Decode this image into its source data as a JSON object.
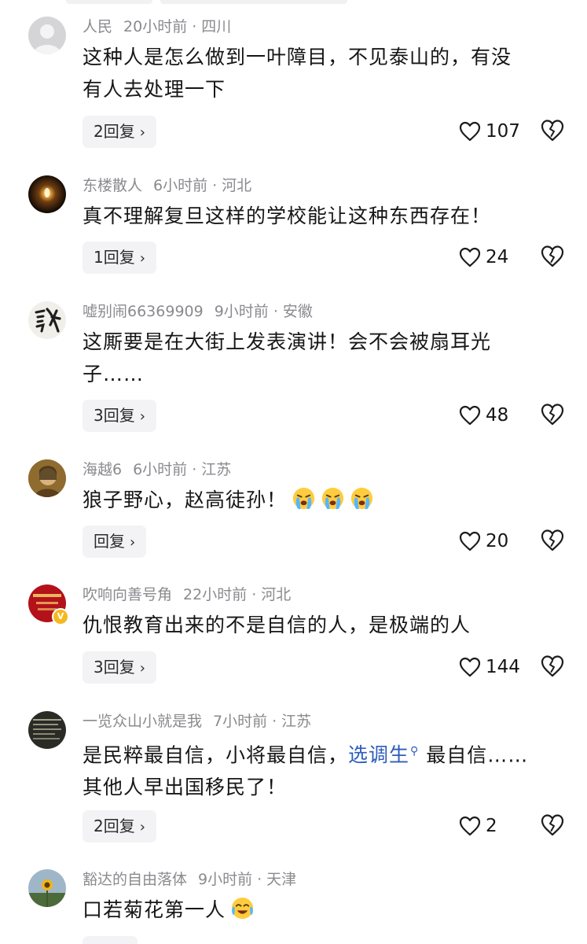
{
  "comments": [
    {
      "avatar": "default-user-avatar",
      "username": "人民",
      "time": "20小时前",
      "location": "四川",
      "lines": [
        "这种人是怎么做到一叶障目，不见泰山的，有没",
        "有人去处理一下"
      ],
      "reply_label": "2回复",
      "likes": "107"
    },
    {
      "avatar": "candle-light-avatar",
      "username": "东楼散人",
      "time": "6小时前",
      "location": "河北",
      "lines": [
        "真不理解复旦这样的学校能让这种东西存在！"
      ],
      "reply_label": "1回复",
      "likes": "24"
    },
    {
      "avatar": "calligraphy-character-avatar",
      "avatar_text": "䛓",
      "username": "嘘别闹66369909",
      "time": "9小时前",
      "location": "安徽",
      "lines": [
        "这厮要是在大街上发表演讲！会不会被扇耳光",
        "子……"
      ],
      "reply_label": "3回复",
      "likes": "48"
    },
    {
      "avatar": "painting-portrait-avatar",
      "username": "海越6",
      "time": "6小时前",
      "location": "江苏",
      "lines": [
        "狼子野心，赵高徒孙！"
      ],
      "emojis": [
        "crying-face-emoji",
        "crying-face-emoji",
        "crying-face-emoji"
      ],
      "reply_label": "回复",
      "likes": "20"
    },
    {
      "avatar": "red-poster-avatar",
      "verified": "V",
      "username": "吹响向善号角",
      "time": "22小时前",
      "location": "河北",
      "lines": [
        "仇恨教育出来的不是自信的人，是极端的人"
      ],
      "reply_label": "3回复",
      "likes": "144"
    },
    {
      "avatar": "dark-text-avatar",
      "username": "一览众山小就是我",
      "time": "7小时前",
      "location": "江苏",
      "line1_before": "是民粹最自信，小将最自信，",
      "link_text": "选调生",
      "link_icon": "search-icon",
      "line1_after": "最自信……",
      "line2": "其他人早出国移民了！",
      "reply_label": "2回复",
      "likes": "2"
    },
    {
      "avatar": "sunflower-avatar",
      "username": "豁达的自由落体",
      "time": "9小时前",
      "location": "天津",
      "lines": [
        "口若菊花第一人"
      ],
      "emojis": [
        "laughing-crying-emoji"
      ]
    }
  ],
  "colors": {
    "meta_gray": "#8a8a8f",
    "text": "#161616",
    "link_blue": "#2e5dbd",
    "reply_bg": "#f3f3f5",
    "badge_yellow": "#f5b820"
  }
}
